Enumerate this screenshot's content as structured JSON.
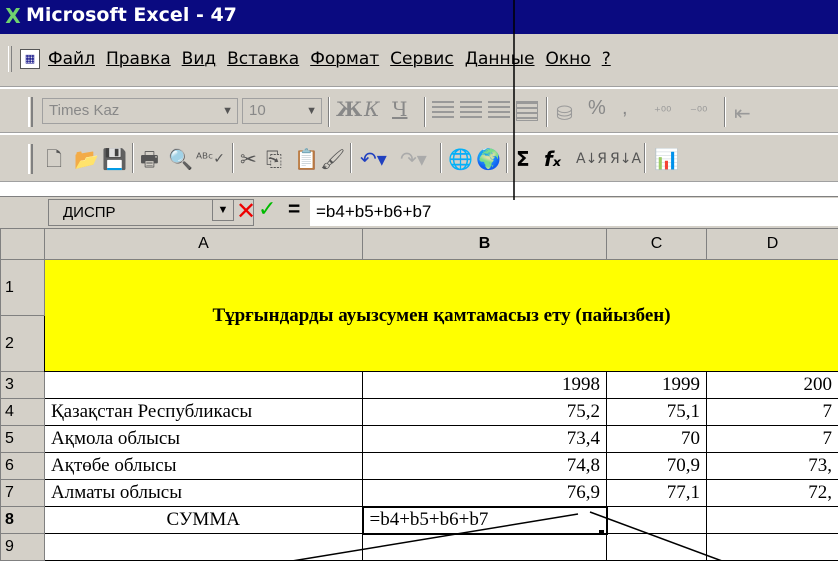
{
  "window": {
    "title": "Microsoft Excel - 47"
  },
  "menu": {
    "items": [
      "Файл",
      "Правка",
      "Вид",
      "Вставка",
      "Формат",
      "Сервис",
      "Данные",
      "Окно",
      "?"
    ]
  },
  "format_toolbar": {
    "font": "Times Kaz",
    "size": "10",
    "bold": "Ж",
    "italic": "К",
    "underline": "Ч",
    "percent": "%",
    "comma": ","
  },
  "standard_toolbar": {
    "sum": "Σ",
    "fx": "fₓ"
  },
  "formula_bar": {
    "name_box": "ДИСПР",
    "cancel": "✕",
    "enter": "✓",
    "equals": "=",
    "formula": "=b4+b5+b6+b7"
  },
  "sheet": {
    "columns": [
      "A",
      "B",
      "C",
      "D"
    ],
    "rows": [
      "1",
      "2",
      "3",
      "4",
      "5",
      "6",
      "7",
      "8",
      "9"
    ],
    "title": "Тұрғындарды ауызсумен қамтамасыз ету (пайызбен)",
    "years": [
      "1998",
      "1999",
      "200"
    ],
    "data": [
      {
        "region": "Қазақстан Республикасы",
        "b": "75,2",
        "c": "75,1",
        "d": "7"
      },
      {
        "region": "Ақмола облысы",
        "b": "73,4",
        "c": "70",
        "d": "7"
      },
      {
        "region": "Ақтөбе облысы",
        "b": "74,8",
        "c": "70,9",
        "d": "73,"
      },
      {
        "region": "Алматы облысы",
        "b": "76,9",
        "c": "77,1",
        "d": "72,"
      }
    ],
    "sum_label": "СУММА",
    "sum_formula": "=b4+b5+b6+b7"
  },
  "colors": {
    "title_bar": "#0a0a80",
    "highlight": "#ffff00",
    "chrome": "#d4d0c8"
  }
}
